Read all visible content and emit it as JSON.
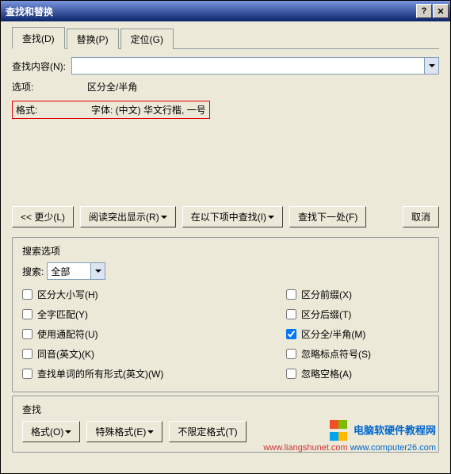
{
  "title": "查找和替换",
  "titlebar": {
    "help": "?",
    "close": "✕"
  },
  "tabs": {
    "find": "查找(D)",
    "replace": "替换(P)",
    "goto": "定位(G)"
  },
  "labels": {
    "find_content": "查找内容(N):",
    "options": "选项:",
    "options_value": "区分全/半角",
    "format": "格式:",
    "format_value": "字体: (中文) 华文行楷, 一号"
  },
  "buttons": {
    "less": "<< 更少(L)",
    "reading_highlight": "阅读突出显示(R)",
    "find_in": "在以下项中查找(I)",
    "find_next": "查找下一处(F)",
    "cancel": "取消",
    "format": "格式(O)",
    "special": "特殊格式(E)",
    "no_format": "不限定格式(T)"
  },
  "search_options": {
    "legend": "搜索选项",
    "search_label": "搜索:",
    "search_value": "全部",
    "match_case": "区分大小写(H)",
    "whole_word": "全字匹配(Y)",
    "wildcards": "使用通配符(U)",
    "sounds_like": "同音(英文)(K)",
    "all_forms": "查找单词的所有形式(英文)(W)",
    "match_prefix": "区分前缀(X)",
    "match_suffix": "区分后缀(T)",
    "full_half": "区分全/半角(M)",
    "ignore_punct": "忽略标点符号(S)",
    "ignore_space": "忽略空格(A)"
  },
  "find_legend": "查找",
  "watermark": {
    "line1": "电脑软硬件教程网",
    "line2_a": "www.liangshunet.com",
    "line2_b": "www.computer26.com",
    "colors": {
      "red": "#f25022",
      "green": "#7fba00",
      "blue": "#00a4ef",
      "yellow": "#ffb900"
    }
  }
}
